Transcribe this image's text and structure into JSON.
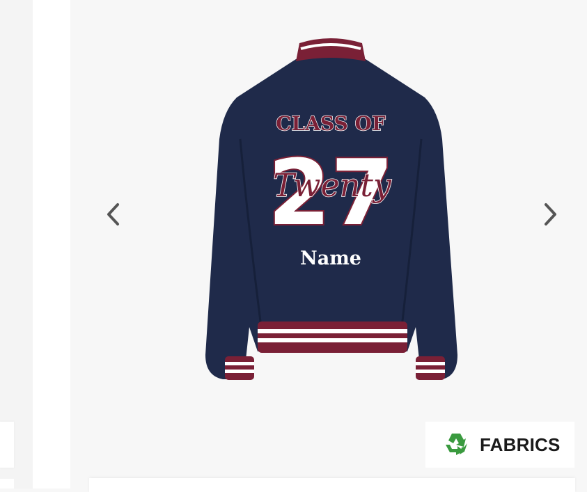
{
  "product": {
    "name_text": "Name",
    "class_text": "CLASS OF",
    "year_text": "27",
    "script_text": "Twenty",
    "colors": {
      "navy": "#1f2a4a",
      "maroon": "#7a2036",
      "white": "#ffffff"
    }
  },
  "gallery": {
    "prev_icon": "chevron-left-icon",
    "next_icon": "chevron-right-icon"
  },
  "badge": {
    "icon": "recycle-icon",
    "label": "FABRICS",
    "icon_color": "#3a9a3f"
  }
}
